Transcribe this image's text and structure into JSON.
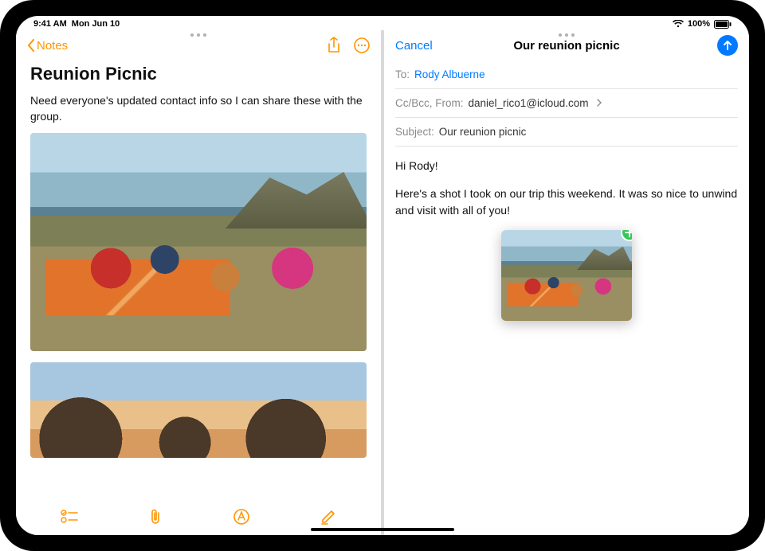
{
  "status": {
    "time": "9:41 AM",
    "date": "Mon Jun 10",
    "battery_pct": "100%"
  },
  "notes": {
    "back_label": "Notes",
    "title": "Reunion Picnic",
    "body": "Need everyone's updated contact info so I can share these with the group.",
    "images": {
      "primary_alt": "picnic-on-cliff-photo",
      "secondary_alt": "sunset-group-photo"
    },
    "toolbar": {
      "checklist": "checklist-icon",
      "attach": "attach-icon",
      "markup": "markup-icon",
      "compose": "compose-icon"
    }
  },
  "mail": {
    "cancel_label": "Cancel",
    "title": "Our reunion picnic",
    "to_label": "To:",
    "to_value": "Rody Albuerne",
    "cc_label": "Cc/Bcc, From:",
    "cc_value": "daniel_rico1@icloud.com",
    "subject_label": "Subject:",
    "subject_value": "Our reunion picnic",
    "body_greeting": "Hi Rody!",
    "body_text": "Here's a shot I took on our trip this weekend. It was so nice to unwind and visit with all of you!",
    "attachment_alt": "picnic-on-cliff-photo",
    "attachment_badge": "add"
  },
  "colors": {
    "notes_accent": "#ff9500",
    "mail_accent": "#007aff",
    "badge_green": "#34c759"
  }
}
